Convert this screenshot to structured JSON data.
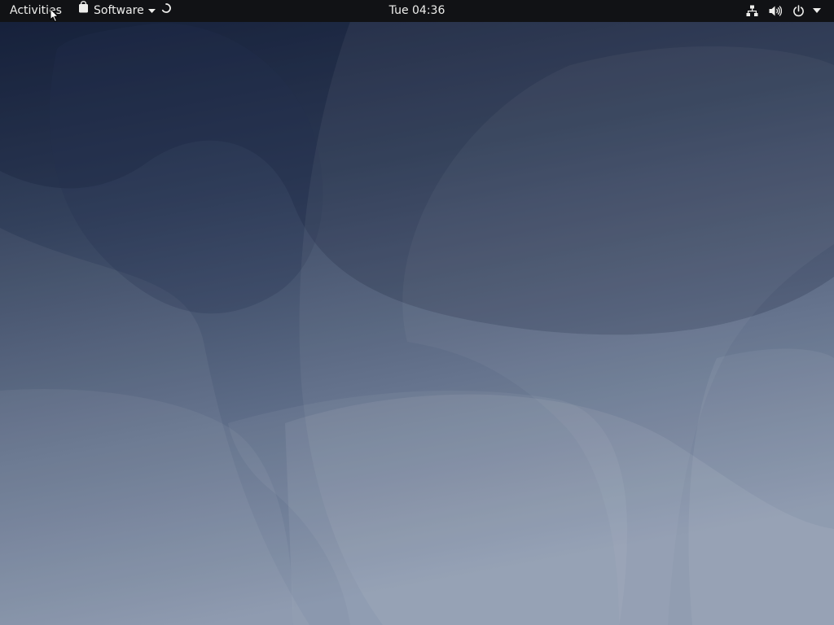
{
  "top_bar": {
    "activities_label": "Activities",
    "app_menu": {
      "label": "Software",
      "icon": "shopping-bag-icon",
      "dropdown_icon": "triangle-down-icon",
      "status_icon": "loading-spinner-icon"
    },
    "clock": "Tue 04:36",
    "status_area": {
      "icons": [
        "network-wired-icon",
        "volume-icon",
        "power-icon",
        "triangle-down-icon"
      ]
    }
  },
  "desktop": {
    "wallpaper_colors": {
      "top": "#1e2a44",
      "middle": "#4d5d7a",
      "bottom": "#8d9ab0"
    }
  },
  "colors": {
    "top_bar_bg": "#111215",
    "top_bar_text": "#eeeeec"
  }
}
